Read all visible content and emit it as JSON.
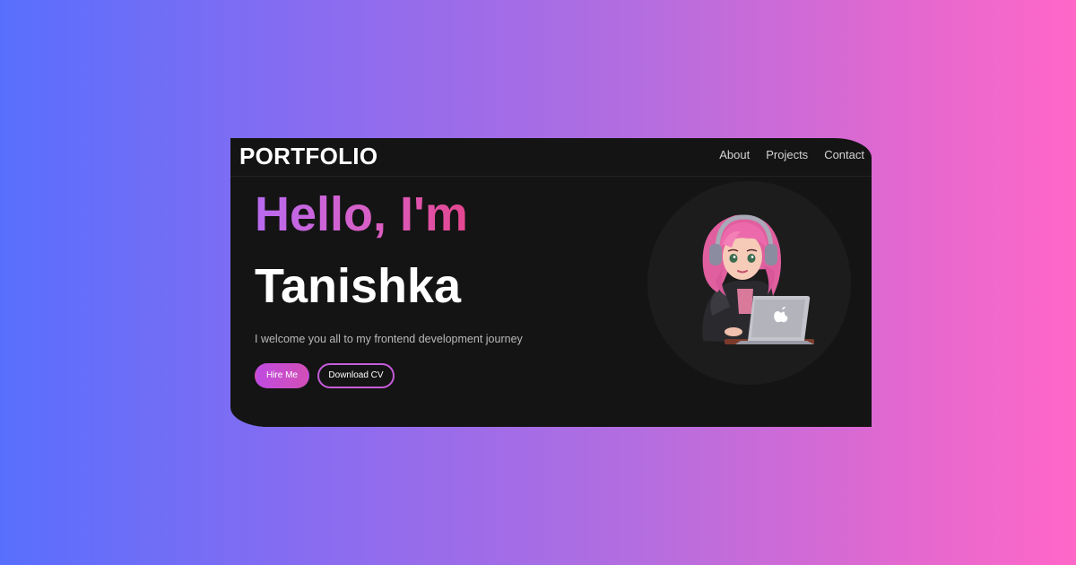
{
  "navbar": {
    "logo": "PORTFOLIO",
    "links": [
      {
        "label": "About"
      },
      {
        "label": "Projects"
      },
      {
        "label": "Contact"
      }
    ]
  },
  "hero": {
    "greeting": "Hello, I'm",
    "name": "Tanishka",
    "tagline": "I welcome you all to my frontend development journey",
    "buttons": {
      "hire_label": "Hire Me",
      "cv_label": "Download CV"
    },
    "avatar": {
      "icon": "girl-with-laptop-avatar"
    }
  },
  "colors": {
    "card_background": "#141414",
    "accent_purple": "#c04be0",
    "accent_pink": "#e4468f",
    "page_gradient_start": "#586ffd",
    "page_gradient_end": "#ff67c8"
  }
}
